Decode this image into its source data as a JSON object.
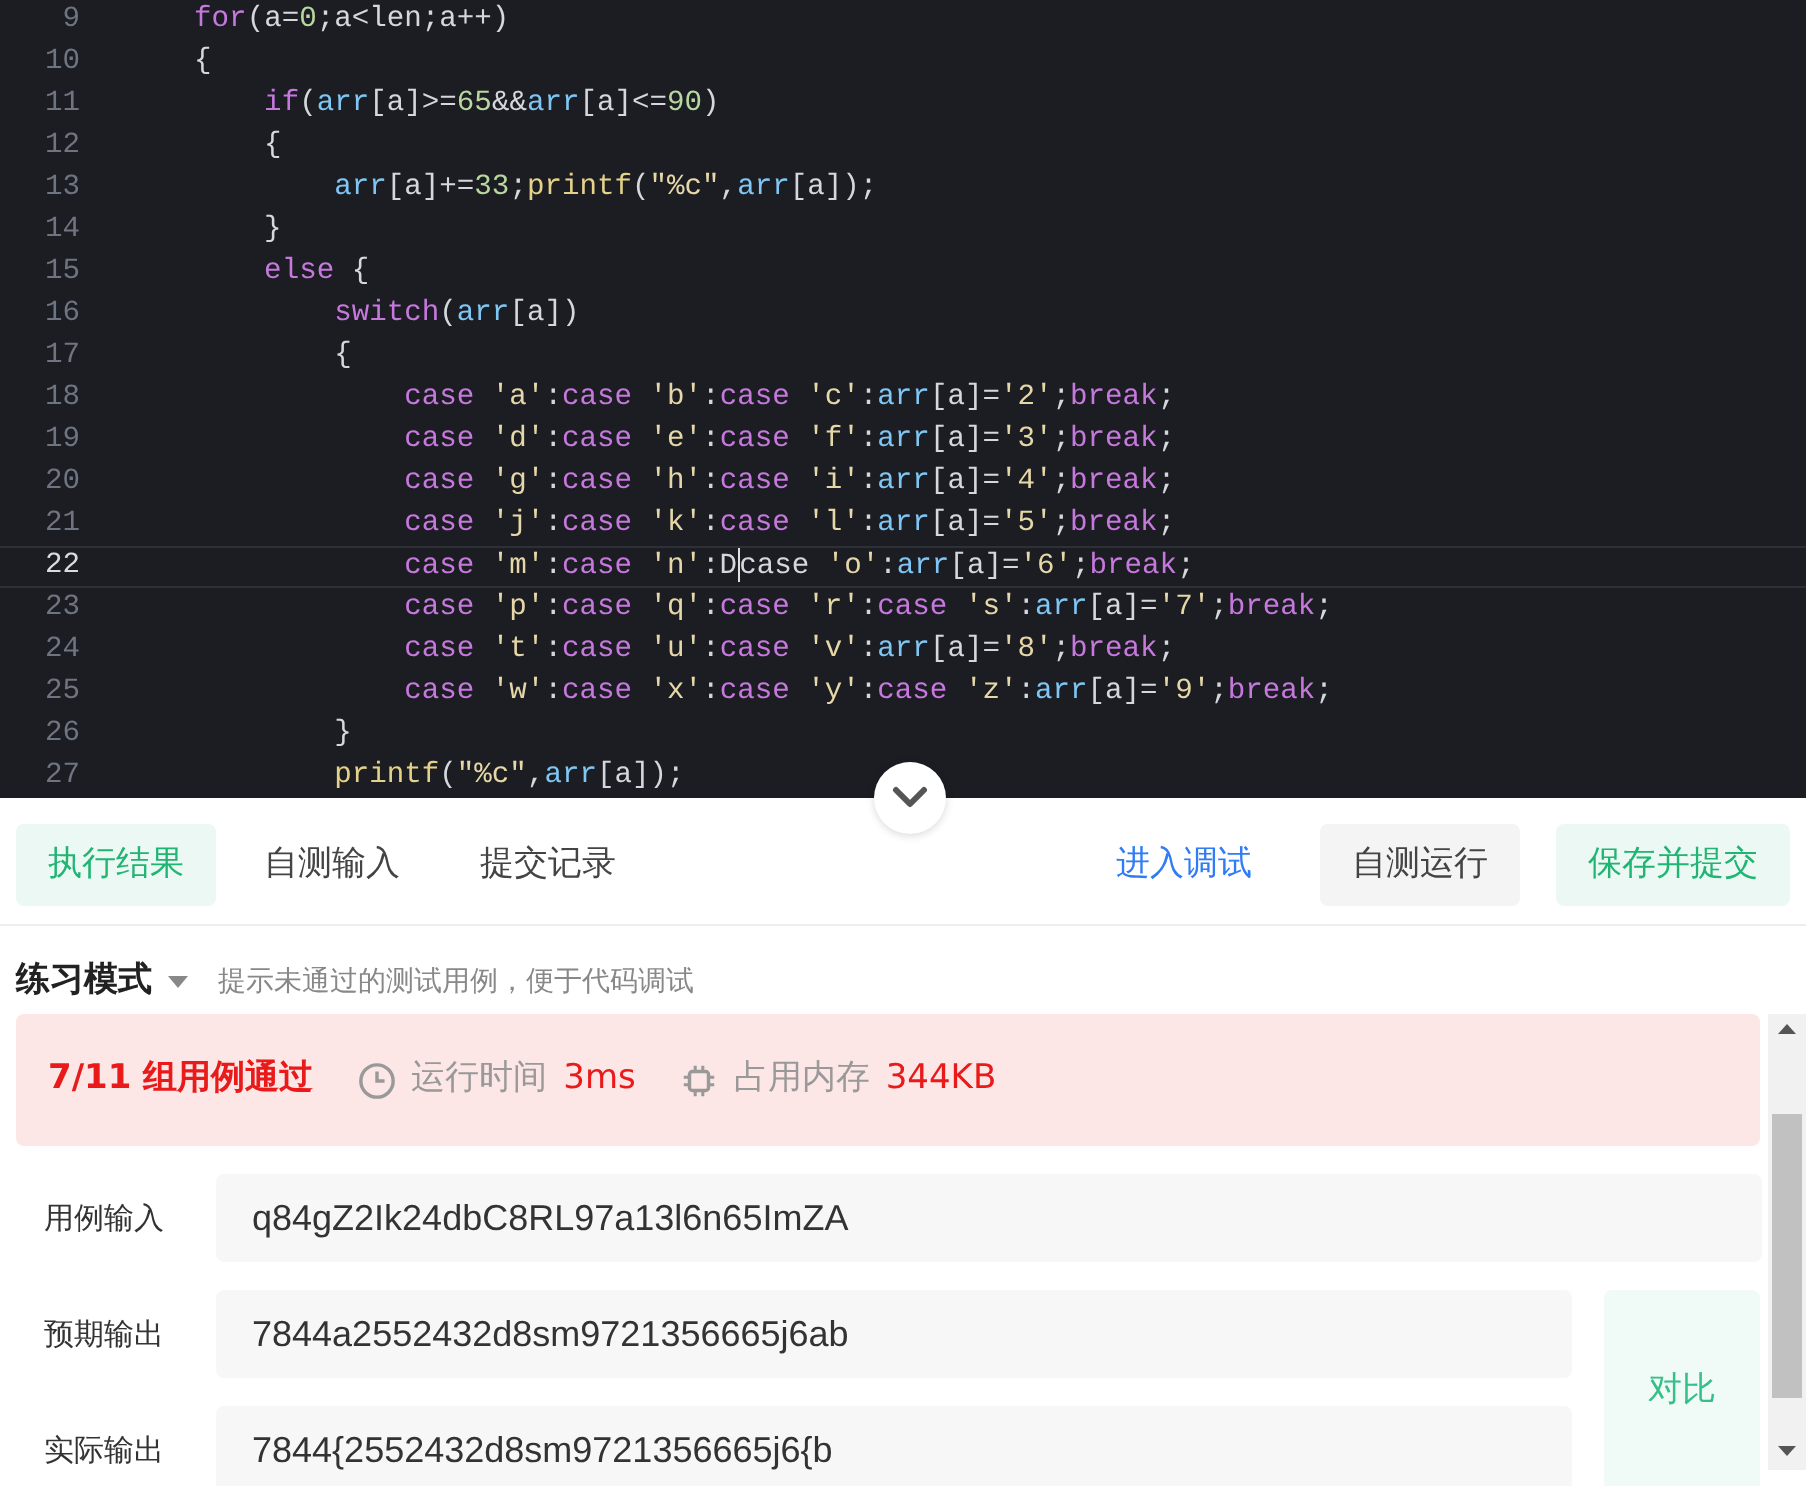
{
  "editor": {
    "lines": [
      {
        "no": "9",
        "current": false,
        "tokens": [
          {
            "kind": "kw",
            "t": "    for"
          },
          {
            "kind": "p",
            "t": "(a="
          },
          {
            "kind": "num",
            "t": "0"
          },
          {
            "kind": "p",
            "t": ";a<len;a++)"
          }
        ]
      },
      {
        "no": "10",
        "current": false,
        "tokens": [
          {
            "kind": "p",
            "t": "    {"
          }
        ]
      },
      {
        "no": "11",
        "current": false,
        "tokens": [
          {
            "kind": "kw",
            "t": "        if"
          },
          {
            "kind": "p",
            "t": "("
          },
          {
            "kind": "var",
            "t": "arr"
          },
          {
            "kind": "p",
            "t": "[a]>="
          },
          {
            "kind": "num",
            "t": "65"
          },
          {
            "kind": "p",
            "t": "&&"
          },
          {
            "kind": "var",
            "t": "arr"
          },
          {
            "kind": "p",
            "t": "[a]<="
          },
          {
            "kind": "num",
            "t": "90"
          },
          {
            "kind": "p",
            "t": ")"
          }
        ]
      },
      {
        "no": "12",
        "current": false,
        "tokens": [
          {
            "kind": "p",
            "t": "        {"
          }
        ]
      },
      {
        "no": "13",
        "current": false,
        "tokens": [
          {
            "kind": "var",
            "t": "            arr"
          },
          {
            "kind": "p",
            "t": "[a]+="
          },
          {
            "kind": "num",
            "t": "33"
          },
          {
            "kind": "p",
            "t": ";"
          },
          {
            "kind": "fn",
            "t": "printf"
          },
          {
            "kind": "p",
            "t": "("
          },
          {
            "kind": "str",
            "t": "\"%c\""
          },
          {
            "kind": "p",
            "t": ","
          },
          {
            "kind": "var",
            "t": "arr"
          },
          {
            "kind": "p",
            "t": "[a]);"
          }
        ]
      },
      {
        "no": "14",
        "current": false,
        "tokens": [
          {
            "kind": "p",
            "t": "        }"
          }
        ]
      },
      {
        "no": "15",
        "current": false,
        "tokens": [
          {
            "kind": "kw",
            "t": "        else"
          },
          {
            "kind": "p",
            "t": " {"
          }
        ]
      },
      {
        "no": "16",
        "current": false,
        "tokens": [
          {
            "kind": "kw",
            "t": "            switch"
          },
          {
            "kind": "p",
            "t": "("
          },
          {
            "kind": "var",
            "t": "arr"
          },
          {
            "kind": "p",
            "t": "[a])"
          }
        ]
      },
      {
        "no": "17",
        "current": false,
        "tokens": [
          {
            "kind": "p",
            "t": "            {"
          }
        ]
      },
      {
        "no": "18",
        "current": false,
        "tokens": [
          {
            "kind": "kw",
            "t": "                case "
          },
          {
            "kind": "str",
            "t": "'a'"
          },
          {
            "kind": "p",
            "t": ":"
          },
          {
            "kind": "kw",
            "t": "case "
          },
          {
            "kind": "str",
            "t": "'b'"
          },
          {
            "kind": "p",
            "t": ":"
          },
          {
            "kind": "kw",
            "t": "case "
          },
          {
            "kind": "str",
            "t": "'c'"
          },
          {
            "kind": "p",
            "t": ":"
          },
          {
            "kind": "var",
            "t": "arr"
          },
          {
            "kind": "p",
            "t": "[a]="
          },
          {
            "kind": "str",
            "t": "'2'"
          },
          {
            "kind": "p",
            "t": ";"
          },
          {
            "kind": "kw",
            "t": "break"
          },
          {
            "kind": "p",
            "t": ";"
          }
        ]
      },
      {
        "no": "19",
        "current": false,
        "tokens": [
          {
            "kind": "kw",
            "t": "                case "
          },
          {
            "kind": "str",
            "t": "'d'"
          },
          {
            "kind": "p",
            "t": ":"
          },
          {
            "kind": "kw",
            "t": "case "
          },
          {
            "kind": "str",
            "t": "'e'"
          },
          {
            "kind": "p",
            "t": ":"
          },
          {
            "kind": "kw",
            "t": "case "
          },
          {
            "kind": "str",
            "t": "'f'"
          },
          {
            "kind": "p",
            "t": ":"
          },
          {
            "kind": "var",
            "t": "arr"
          },
          {
            "kind": "p",
            "t": "[a]="
          },
          {
            "kind": "str",
            "t": "'3'"
          },
          {
            "kind": "p",
            "t": ";"
          },
          {
            "kind": "kw",
            "t": "break"
          },
          {
            "kind": "p",
            "t": ";"
          }
        ]
      },
      {
        "no": "20",
        "current": false,
        "tokens": [
          {
            "kind": "kw",
            "t": "                case "
          },
          {
            "kind": "str",
            "t": "'g'"
          },
          {
            "kind": "p",
            "t": ":"
          },
          {
            "kind": "kw",
            "t": "case "
          },
          {
            "kind": "str",
            "t": "'h'"
          },
          {
            "kind": "p",
            "t": ":"
          },
          {
            "kind": "kw",
            "t": "case "
          },
          {
            "kind": "str",
            "t": "'i'"
          },
          {
            "kind": "p",
            "t": ":"
          },
          {
            "kind": "var",
            "t": "arr"
          },
          {
            "kind": "p",
            "t": "[a]="
          },
          {
            "kind": "str",
            "t": "'4'"
          },
          {
            "kind": "p",
            "t": ";"
          },
          {
            "kind": "kw",
            "t": "break"
          },
          {
            "kind": "p",
            "t": ";"
          }
        ]
      },
      {
        "no": "21",
        "current": false,
        "tokens": [
          {
            "kind": "kw",
            "t": "                case "
          },
          {
            "kind": "str",
            "t": "'j'"
          },
          {
            "kind": "p",
            "t": ":"
          },
          {
            "kind": "kw",
            "t": "case "
          },
          {
            "kind": "str",
            "t": "'k'"
          },
          {
            "kind": "p",
            "t": ":"
          },
          {
            "kind": "kw",
            "t": "case "
          },
          {
            "kind": "str",
            "t": "'l'"
          },
          {
            "kind": "p",
            "t": ":"
          },
          {
            "kind": "var",
            "t": "arr"
          },
          {
            "kind": "p",
            "t": "[a]="
          },
          {
            "kind": "str",
            "t": "'5'"
          },
          {
            "kind": "p",
            "t": ";"
          },
          {
            "kind": "kw",
            "t": "break"
          },
          {
            "kind": "p",
            "t": ";"
          }
        ]
      },
      {
        "no": "22",
        "current": true,
        "tokens": [
          {
            "kind": "kw",
            "t": "                case "
          },
          {
            "kind": "str",
            "t": "'m'"
          },
          {
            "kind": "p",
            "t": ":"
          },
          {
            "kind": "kw",
            "t": "case "
          },
          {
            "kind": "str",
            "t": "'n'"
          },
          {
            "kind": "p",
            "t": ":D",
            "caret_after": true
          },
          {
            "kind": "p",
            "t": "case "
          },
          {
            "kind": "str",
            "t": "'o'"
          },
          {
            "kind": "p",
            "t": ":"
          },
          {
            "kind": "var",
            "t": "arr"
          },
          {
            "kind": "p",
            "t": "[a]="
          },
          {
            "kind": "str",
            "t": "'6'"
          },
          {
            "kind": "p",
            "t": ";"
          },
          {
            "kind": "kw",
            "t": "break"
          },
          {
            "kind": "p",
            "t": ";"
          }
        ]
      },
      {
        "no": "23",
        "current": false,
        "tokens": [
          {
            "kind": "kw",
            "t": "                case "
          },
          {
            "kind": "str",
            "t": "'p'"
          },
          {
            "kind": "p",
            "t": ":"
          },
          {
            "kind": "kw",
            "t": "case "
          },
          {
            "kind": "str",
            "t": "'q'"
          },
          {
            "kind": "p",
            "t": ":"
          },
          {
            "kind": "kw",
            "t": "case "
          },
          {
            "kind": "str",
            "t": "'r'"
          },
          {
            "kind": "p",
            "t": ":"
          },
          {
            "kind": "kw",
            "t": "case "
          },
          {
            "kind": "str",
            "t": "'s'"
          },
          {
            "kind": "p",
            "t": ":"
          },
          {
            "kind": "var",
            "t": "arr"
          },
          {
            "kind": "p",
            "t": "[a]="
          },
          {
            "kind": "str",
            "t": "'7'"
          },
          {
            "kind": "p",
            "t": ";"
          },
          {
            "kind": "kw",
            "t": "break"
          },
          {
            "kind": "p",
            "t": ";"
          }
        ]
      },
      {
        "no": "24",
        "current": false,
        "tokens": [
          {
            "kind": "kw",
            "t": "                case "
          },
          {
            "kind": "str",
            "t": "'t'"
          },
          {
            "kind": "p",
            "t": ":"
          },
          {
            "kind": "kw",
            "t": "case "
          },
          {
            "kind": "str",
            "t": "'u'"
          },
          {
            "kind": "p",
            "t": ":"
          },
          {
            "kind": "kw",
            "t": "case "
          },
          {
            "kind": "str",
            "t": "'v'"
          },
          {
            "kind": "p",
            "t": ":"
          },
          {
            "kind": "var",
            "t": "arr"
          },
          {
            "kind": "p",
            "t": "[a]="
          },
          {
            "kind": "str",
            "t": "'8'"
          },
          {
            "kind": "p",
            "t": ";"
          },
          {
            "kind": "kw",
            "t": "break"
          },
          {
            "kind": "p",
            "t": ";"
          }
        ]
      },
      {
        "no": "25",
        "current": false,
        "tokens": [
          {
            "kind": "kw",
            "t": "                case "
          },
          {
            "kind": "str",
            "t": "'w'"
          },
          {
            "kind": "p",
            "t": ":"
          },
          {
            "kind": "kw",
            "t": "case "
          },
          {
            "kind": "str",
            "t": "'x'"
          },
          {
            "kind": "p",
            "t": ":"
          },
          {
            "kind": "kw",
            "t": "case "
          },
          {
            "kind": "str",
            "t": "'y'"
          },
          {
            "kind": "p",
            "t": ":"
          },
          {
            "kind": "kw",
            "t": "case "
          },
          {
            "kind": "str",
            "t": "'z'"
          },
          {
            "kind": "p",
            "t": ":"
          },
          {
            "kind": "var",
            "t": "arr"
          },
          {
            "kind": "p",
            "t": "[a]="
          },
          {
            "kind": "str",
            "t": "'9'"
          },
          {
            "kind": "p",
            "t": ";"
          },
          {
            "kind": "kw",
            "t": "break"
          },
          {
            "kind": "p",
            "t": ";"
          }
        ]
      },
      {
        "no": "26",
        "current": false,
        "tokens": [
          {
            "kind": "p",
            "t": "            }"
          }
        ]
      },
      {
        "no": "27",
        "current": false,
        "tokens": [
          {
            "kind": "fn",
            "t": "            printf"
          },
          {
            "kind": "p",
            "t": "("
          },
          {
            "kind": "str",
            "t": "\"%c\""
          },
          {
            "kind": "p",
            "t": ","
          },
          {
            "kind": "var",
            "t": "arr"
          },
          {
            "kind": "p",
            "t": "[a]);"
          }
        ]
      }
    ]
  },
  "tabs": [
    {
      "label": "执行结果",
      "selected": true
    },
    {
      "label": "自测输入",
      "selected": false
    },
    {
      "label": "提交记录",
      "selected": false
    }
  ],
  "actions": [
    {
      "label": "进入调试",
      "kind": "link"
    },
    {
      "label": "自测运行",
      "kind": "secondary"
    },
    {
      "label": "保存并提交",
      "kind": "primary"
    }
  ],
  "mode": {
    "label": "练习模式",
    "hint": "提示未通过的测试用例，便于代码调试"
  },
  "result": {
    "summary": "7/11 组用例通过",
    "time_label": "运行时间",
    "time": "3ms",
    "memory_label": "占用内存",
    "memory": "344KB"
  },
  "cases": [
    {
      "label": "用例输入",
      "value": "q84gZ2Ik24dbC8RL97a13l6n65ImZA"
    },
    {
      "label": "预期输出",
      "value": "7844a2552432d8sm9721356665j6ab"
    },
    {
      "label": "实际输出",
      "value": "7844{2552432d8sm9721356665j6{b"
    }
  ],
  "compare_button": "对比"
}
